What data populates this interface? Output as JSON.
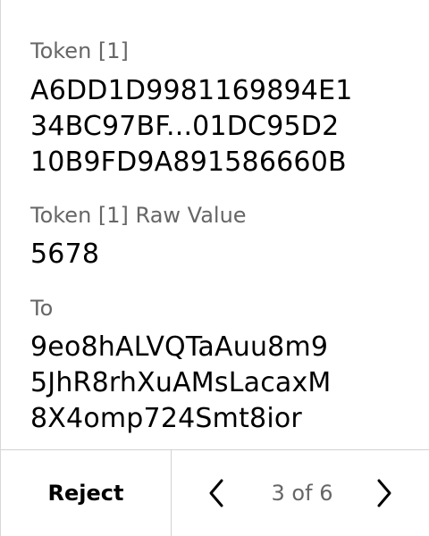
{
  "fields": [
    {
      "label": "Token [1]",
      "lines": [
        "A6DD1D9981169894E1",
        "34BC97BF...01DC95D2",
        "10B9FD9A891586660B"
      ]
    },
    {
      "label": "Token [1] Raw Value",
      "lines": [
        "5678"
      ]
    },
    {
      "label": "To",
      "lines": [
        "9eo8hALVQTaAuu8m9",
        "5JhR8rhXuAMsLacaxM",
        "8X4omp724Smt8ior"
      ]
    }
  ],
  "footer": {
    "reject_label": "Reject",
    "page_indicator": "3 of 6",
    "prev_icon": "chevron-left-icon",
    "next_icon": "chevron-right-icon"
  },
  "colors": {
    "label": "#666666",
    "value": "#000000",
    "divider": "#d2d2d2"
  }
}
